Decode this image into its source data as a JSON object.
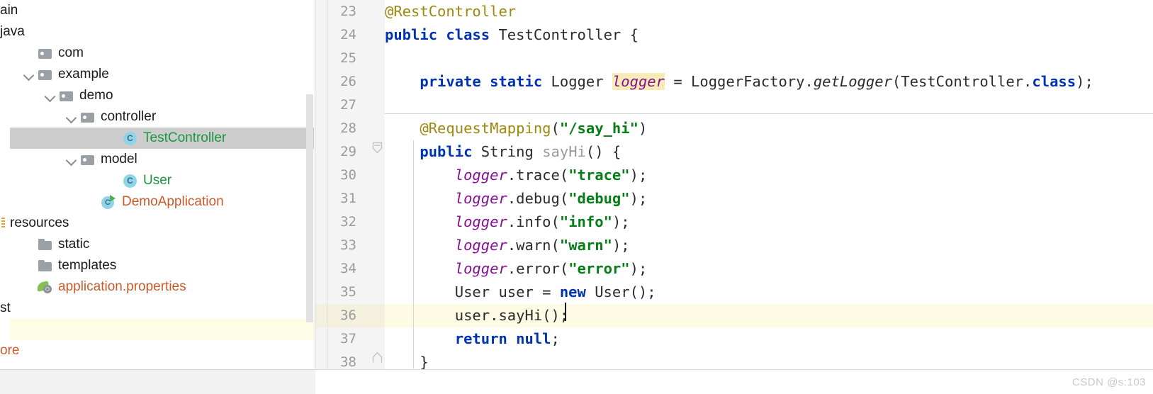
{
  "sidebar": {
    "scrollbar_present": true,
    "tree": [
      {
        "label": "ain",
        "indent": 0,
        "icon": "none",
        "color": "default",
        "chevron": false,
        "state": "clipped"
      },
      {
        "label": "java",
        "indent": 0,
        "icon": "none",
        "color": "default",
        "chevron": false,
        "state": "clipped"
      },
      {
        "label": "com",
        "indent": 1,
        "icon": "package-folder",
        "color": "default",
        "chevron": false,
        "state": "normal"
      },
      {
        "label": "example",
        "indent": 1,
        "icon": "package-folder",
        "color": "default",
        "chevron": true,
        "state": "normal"
      },
      {
        "label": "demo",
        "indent": 2,
        "icon": "package-folder",
        "color": "default",
        "chevron": true,
        "state": "normal"
      },
      {
        "label": "controller",
        "indent": 3,
        "icon": "package-folder",
        "color": "default",
        "chevron": true,
        "state": "normal"
      },
      {
        "label": "TestController",
        "indent": 5,
        "icon": "java-class",
        "color": "green",
        "chevron": false,
        "state": "selected"
      },
      {
        "label": "model",
        "indent": 3,
        "icon": "package-folder",
        "color": "default",
        "chevron": true,
        "state": "normal"
      },
      {
        "label": "User",
        "indent": 5,
        "icon": "java-class",
        "color": "green",
        "chevron": false,
        "state": "normal"
      },
      {
        "label": "DemoApplication",
        "indent": 4,
        "icon": "runnable-class",
        "color": "orange",
        "chevron": false,
        "state": "normal"
      },
      {
        "label": "resources",
        "indent": 0,
        "icon": "resources-root",
        "color": "default",
        "chevron": false,
        "state": "normal"
      },
      {
        "label": "static",
        "indent": 1,
        "icon": "folder",
        "color": "default",
        "chevron": false,
        "state": "normal"
      },
      {
        "label": "templates",
        "indent": 1,
        "icon": "folder",
        "color": "default",
        "chevron": false,
        "state": "normal"
      },
      {
        "label": "application.properties",
        "indent": 1,
        "icon": "spring-leaf",
        "color": "orange",
        "chevron": false,
        "state": "normal"
      },
      {
        "label": "st",
        "indent": 0,
        "icon": "none",
        "color": "default",
        "chevron": false,
        "state": "clipped"
      },
      {
        "label": "",
        "indent": 0,
        "icon": "none",
        "color": "default",
        "chevron": false,
        "state": "highlighted"
      },
      {
        "label": "ore",
        "indent": 0,
        "icon": "none",
        "color": "orange",
        "chevron": false,
        "state": "clipped"
      }
    ]
  },
  "editor": {
    "caret_line_number": "36",
    "first_line_number": "23",
    "last_line_number": "38",
    "lines": [
      {
        "num": "23",
        "tokens": [
          {
            "t": "@RestController",
            "c": "ann"
          }
        ]
      },
      {
        "num": "24",
        "tokens": [
          {
            "t": "public",
            "c": "k"
          },
          {
            "t": " ",
            "c": "pl"
          },
          {
            "t": "class",
            "c": "k"
          },
          {
            "t": " TestController {",
            "c": "pl"
          }
        ]
      },
      {
        "num": "25",
        "tokens": []
      },
      {
        "num": "26",
        "tokens": [
          {
            "t": "    ",
            "c": "pl"
          },
          {
            "t": "private",
            "c": "k"
          },
          {
            "t": " ",
            "c": "pl"
          },
          {
            "t": "static",
            "c": "k"
          },
          {
            "t": " Logger ",
            "c": "pl"
          },
          {
            "t": "logger",
            "c": "fldhl"
          },
          {
            "t": " = LoggerFactory.",
            "c": "pl"
          },
          {
            "t": "getLogger",
            "c": "mths"
          },
          {
            "t": "(TestController.",
            "c": "pl"
          },
          {
            "t": "class",
            "c": "k"
          },
          {
            "t": ");",
            "c": "pl"
          }
        ]
      },
      {
        "num": "27",
        "tokens": []
      },
      {
        "num": "28",
        "tokens": [
          {
            "t": "    ",
            "c": "pl"
          },
          {
            "t": "@RequestMapping",
            "c": "ann"
          },
          {
            "t": "(",
            "c": "pl"
          },
          {
            "t": "\"/say_hi\"",
            "c": "str"
          },
          {
            "t": ")",
            "c": "pl"
          }
        ]
      },
      {
        "num": "29",
        "tokens": [
          {
            "t": "    ",
            "c": "pl"
          },
          {
            "t": "public",
            "c": "k"
          },
          {
            "t": " String ",
            "c": "pl"
          },
          {
            "t": "sayHi",
            "c": "decl"
          },
          {
            "t": "() {",
            "c": "pl"
          }
        ]
      },
      {
        "num": "30",
        "tokens": [
          {
            "t": "        ",
            "c": "pl"
          },
          {
            "t": "logger",
            "c": "fld"
          },
          {
            "t": ".trace(",
            "c": "pl"
          },
          {
            "t": "\"trace\"",
            "c": "str"
          },
          {
            "t": ");",
            "c": "pl"
          }
        ]
      },
      {
        "num": "31",
        "tokens": [
          {
            "t": "        ",
            "c": "pl"
          },
          {
            "t": "logger",
            "c": "fld"
          },
          {
            "t": ".debug(",
            "c": "pl"
          },
          {
            "t": "\"debug\"",
            "c": "str"
          },
          {
            "t": ");",
            "c": "pl"
          }
        ]
      },
      {
        "num": "32",
        "tokens": [
          {
            "t": "        ",
            "c": "pl"
          },
          {
            "t": "logger",
            "c": "fld"
          },
          {
            "t": ".info(",
            "c": "pl"
          },
          {
            "t": "\"info\"",
            "c": "str"
          },
          {
            "t": ");",
            "c": "pl"
          }
        ]
      },
      {
        "num": "33",
        "tokens": [
          {
            "t": "        ",
            "c": "pl"
          },
          {
            "t": "logger",
            "c": "fld"
          },
          {
            "t": ".warn(",
            "c": "pl"
          },
          {
            "t": "\"warn\"",
            "c": "str"
          },
          {
            "t": ");",
            "c": "pl"
          }
        ]
      },
      {
        "num": "34",
        "tokens": [
          {
            "t": "        ",
            "c": "pl"
          },
          {
            "t": "logger",
            "c": "fld"
          },
          {
            "t": ".error(",
            "c": "pl"
          },
          {
            "t": "\"error\"",
            "c": "str"
          },
          {
            "t": ");",
            "c": "pl"
          }
        ]
      },
      {
        "num": "35",
        "tokens": [
          {
            "t": "        User user = ",
            "c": "pl"
          },
          {
            "t": "new",
            "c": "k"
          },
          {
            "t": " User();",
            "c": "pl"
          }
        ]
      },
      {
        "num": "36",
        "tokens": [
          {
            "t": "        user.sayHi();",
            "c": "pl"
          }
        ]
      },
      {
        "num": "37",
        "tokens": [
          {
            "t": "        ",
            "c": "pl"
          },
          {
            "t": "return",
            "c": "k"
          },
          {
            "t": " ",
            "c": "pl"
          },
          {
            "t": "null",
            "c": "k"
          },
          {
            "t": ";",
            "c": "pl"
          }
        ]
      },
      {
        "num": "38",
        "tokens": [
          {
            "t": "    }",
            "c": "pl"
          }
        ]
      }
    ],
    "fold_markers": [
      {
        "line": "29",
        "type": "fold-start-icon"
      },
      {
        "line": "38",
        "type": "fold-end-icon"
      }
    ]
  },
  "watermark": {
    "text": "CSDN @s:103"
  },
  "colors": {
    "keyword": "#0033b3",
    "annotation": "#9e880d",
    "string": "#067d17",
    "field": "#871094",
    "highlight_background": "#f7ecb5",
    "caret_line_background": "#fdfbe3",
    "selection_background": "#cdcdcd",
    "class_label": "#1a9641",
    "properties_label": "#cc5a28",
    "gutter_background": "#f4f4f4",
    "editor_background": "#ffffff"
  }
}
